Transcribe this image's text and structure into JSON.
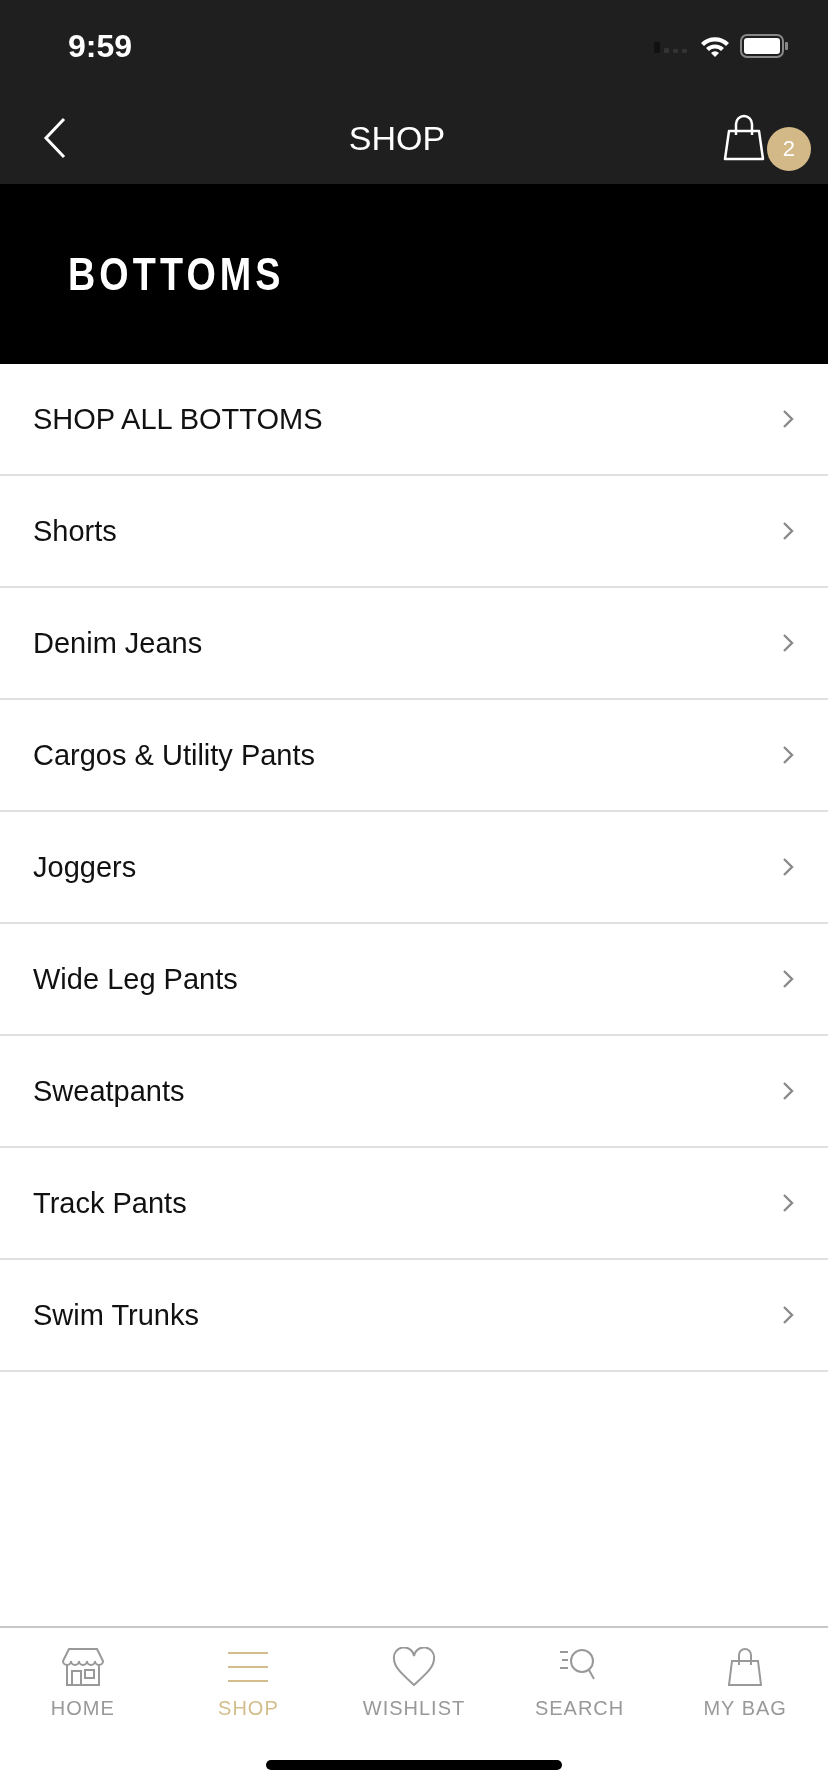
{
  "status_bar": {
    "time": "9:59"
  },
  "nav": {
    "title": "SHOP",
    "bag_count": "2"
  },
  "banner": {
    "title": "BOTTOMS"
  },
  "categories": [
    {
      "label": "SHOP ALL BOTTOMS"
    },
    {
      "label": "Shorts"
    },
    {
      "label": "Denim Jeans"
    },
    {
      "label": "Cargos & Utility Pants"
    },
    {
      "label": "Joggers"
    },
    {
      "label": "Wide Leg Pants"
    },
    {
      "label": "Sweatpants"
    },
    {
      "label": "Track Pants"
    },
    {
      "label": "Swim Trunks"
    }
  ],
  "tab_bar": [
    {
      "kind": "home",
      "label": "HOME",
      "selected": false
    },
    {
      "kind": "shop",
      "label": "SHOP",
      "selected": true
    },
    {
      "kind": "wishlist",
      "label": "WISHLIST",
      "selected": false
    },
    {
      "kind": "search",
      "label": "SEARCH",
      "selected": false
    },
    {
      "kind": "bag",
      "label": "MY BAG",
      "selected": false
    }
  ]
}
